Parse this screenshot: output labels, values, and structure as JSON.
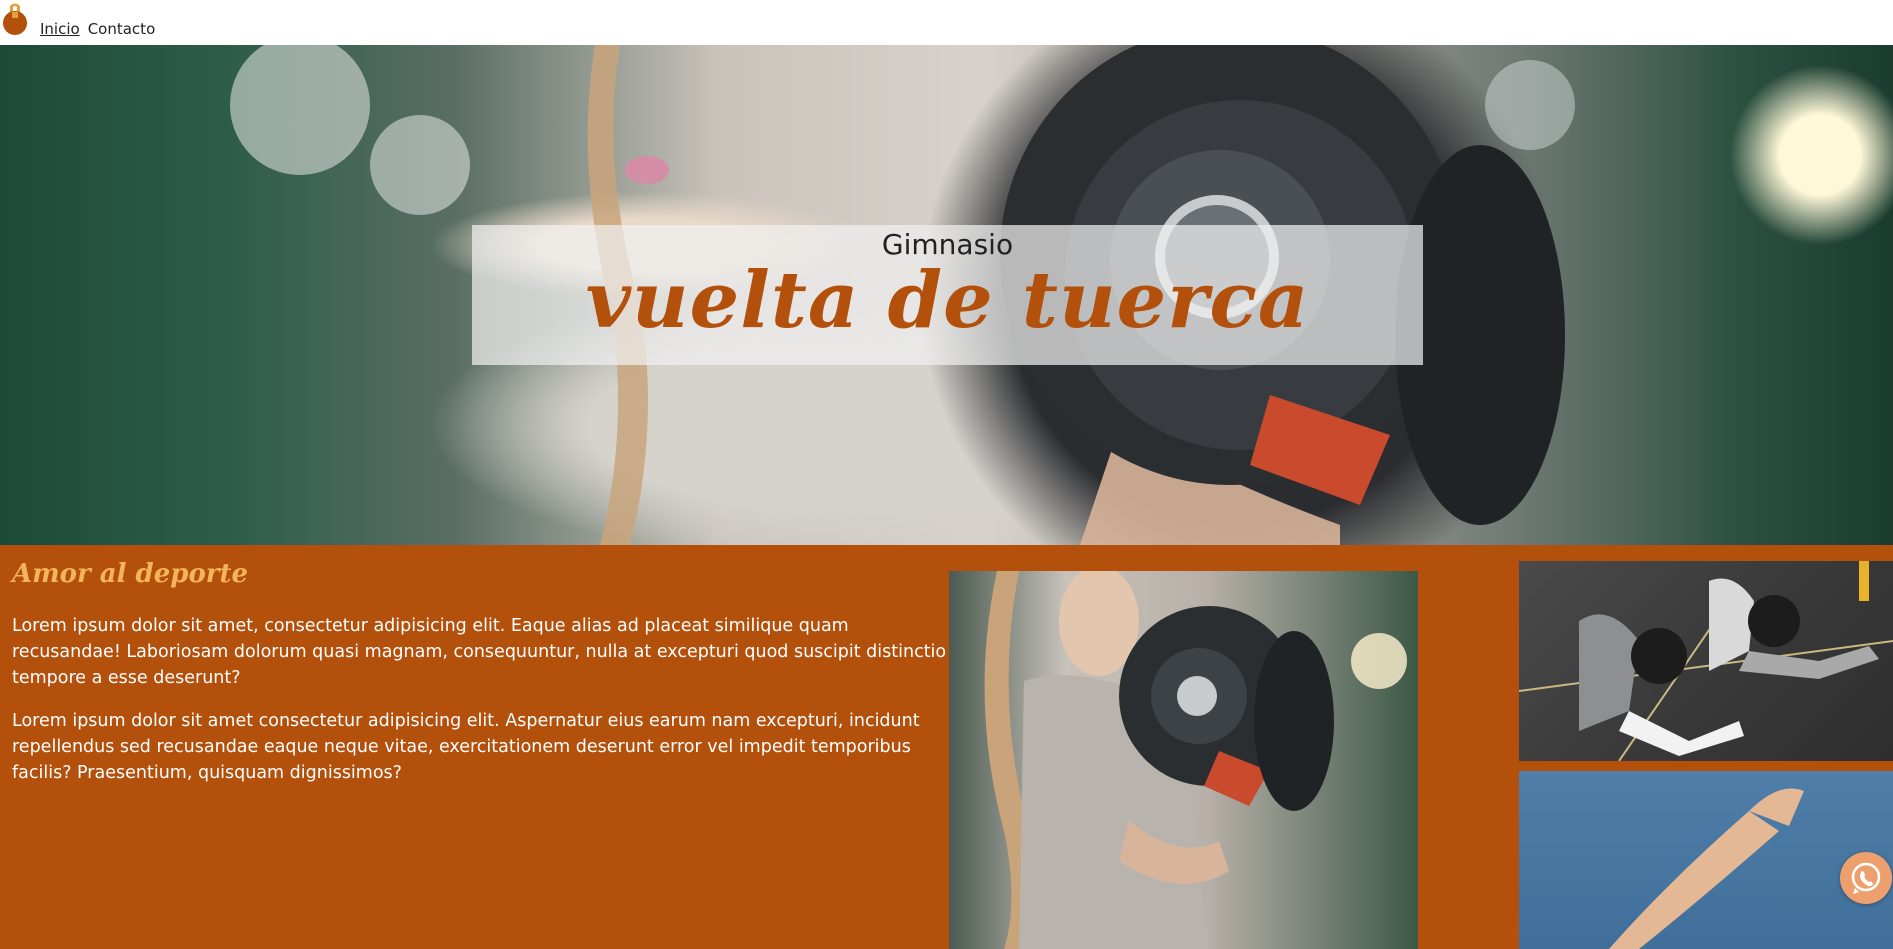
{
  "nav": {
    "items": [
      {
        "label": "Inicio",
        "active": true
      },
      {
        "label": "Contacto",
        "active": false
      }
    ]
  },
  "hero": {
    "subtitle": "Gimnasio",
    "title": "vuelta de tuerca"
  },
  "section": {
    "title": "Amor al deporte",
    "paragraph_1": "Lorem ipsum dolor sit amet, consectetur adipisicing elit. Eaque alias ad placeat similique quam recusandae! Laboriosam dolorum quasi magnam, consequuntur, nulla at excepturi quod suscipit distinctio tempore a esse deserunt?",
    "paragraph_2": "Lorem ipsum dolor sit amet consectetur adipisicing elit. Aspernatur eius earum nam excepturi, incidunt repellendus sed recusandae eaque neque vitae, exercitationem deserunt error vel impedit temporibus facilis? Praesentium, quisquam dignissimos?"
  },
  "colors": {
    "accent": "#b3500b",
    "heading_gold": "#f4b45a",
    "whatsapp_button": "#ee9f6e"
  },
  "icons": {
    "logo": "kettlebell-icon",
    "whatsapp": "whatsapp-icon"
  }
}
